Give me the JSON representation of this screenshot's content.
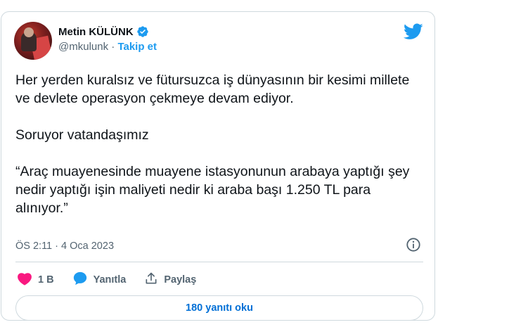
{
  "author": {
    "name": "Metin KÜLÜNK",
    "handle": "@mkulunk",
    "separator": "·",
    "follow_label": "Takip et"
  },
  "tweet": {
    "paragraphs": [
      "Her yerden kuralsız ve fütursuzca iş dünyasının bir kesimi millete ve devlete operasyon çekmeye devam ediyor.",
      "Soruyor vatandaşımız",
      "“Araç muayenesinde muayene istasyonunun arabaya yaptığı şey nedir yaptığı işin maliyeti nedir ki araba başı 1.250 TL para alınıyor.”"
    ],
    "time": "ÖS 2:11",
    "date_separator": "·",
    "date": "4 Oca 2023"
  },
  "actions": {
    "like_count": "1 B",
    "reply_label": "Yanıtla",
    "share_label": "Paylaş"
  },
  "replies_button": {
    "label": "180 yanıtı oku"
  },
  "colors": {
    "brand_blue": "#1d9bf0",
    "like_pink": "#f91880",
    "verified_blue": "#1d9bf0"
  },
  "icons": [
    "verified-badge-icon",
    "twitter-bird-icon",
    "info-icon",
    "heart-icon",
    "reply-bubble-icon",
    "share-icon"
  ]
}
